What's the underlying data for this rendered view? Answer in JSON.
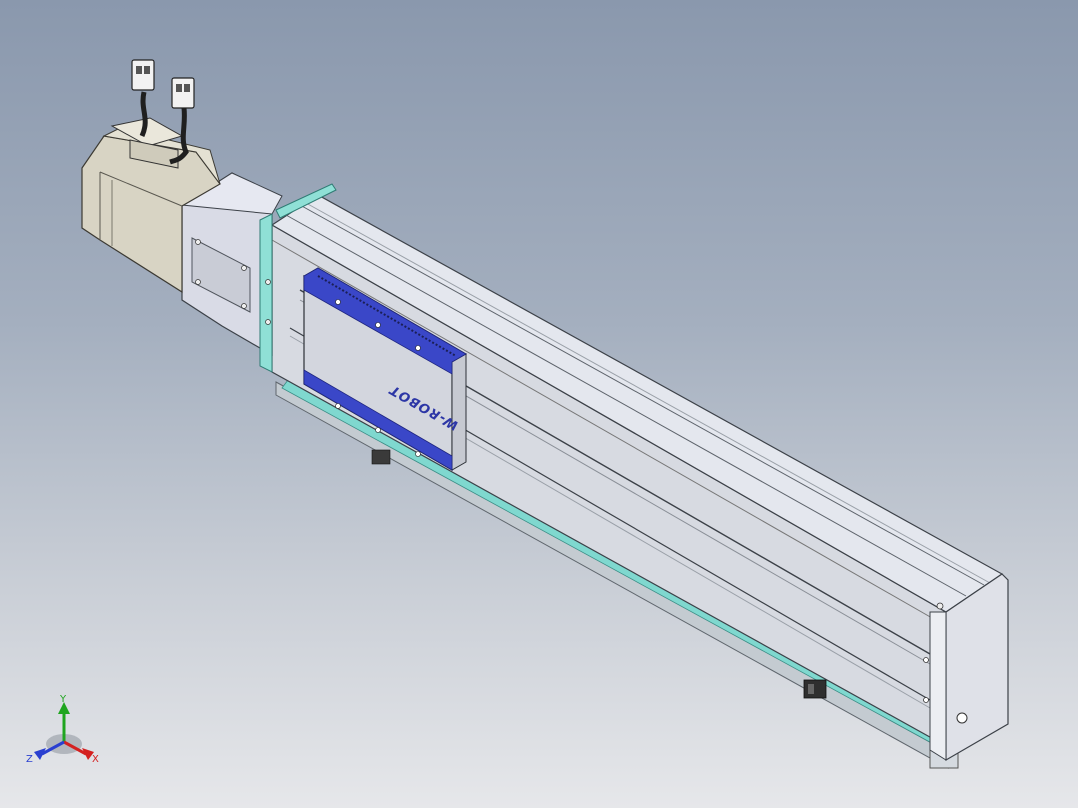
{
  "viewport": {
    "background_top": "#8a98ad",
    "background_bottom": "#e6e7ea"
  },
  "model": {
    "carriage_logo": "W-ROBOT",
    "parts": [
      "servo-motor",
      "motor-connector-cable",
      "encoder-connector-cable",
      "motor-adapter-flange",
      "linear-actuator-body",
      "carriage",
      "end-cap",
      "base-rail",
      "limit-sensor"
    ],
    "colors": {
      "motor": "#d8d4c4",
      "aluminum": "#dfe2ea",
      "carriage_accent": "#3a47c8",
      "rail_accent": "#7fd8cf"
    }
  },
  "triad": {
    "x_label": "X",
    "y_label": "Y",
    "z_label": "Z",
    "x_color": "#d42020",
    "y_color": "#1fa51f",
    "z_color": "#2a3fd0"
  }
}
